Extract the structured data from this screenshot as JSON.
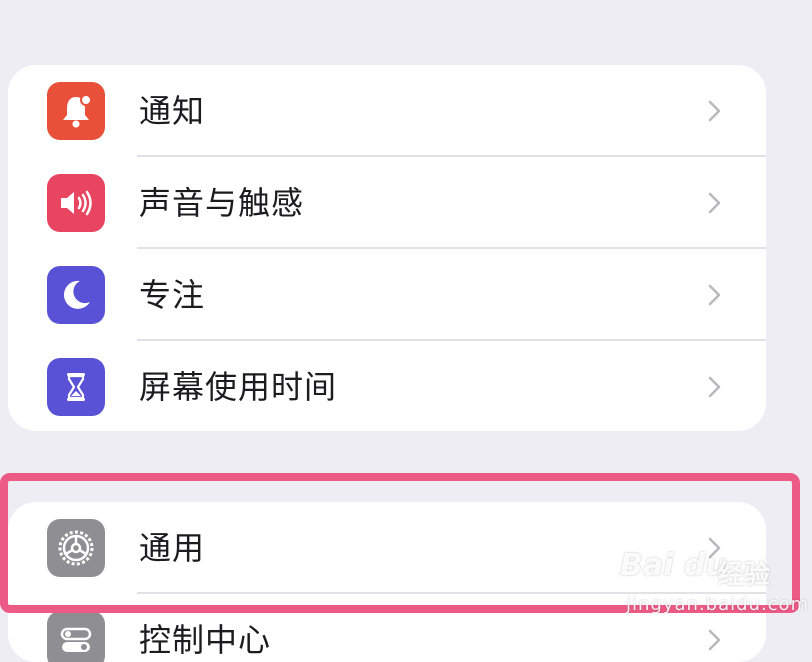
{
  "colors": {
    "background": "#eeedf3",
    "card": "#ffffff",
    "notifications_icon_bg": "#e8503a",
    "sounds_icon_bg": "#e84660",
    "focus_icon_bg": "#5a52d6",
    "screen_time_icon_bg": "#5a52d6",
    "general_icon_bg": "#8e8e93",
    "control_center_icon_bg": "#8e8e93",
    "highlight_border": "#ec5b86"
  },
  "settings": {
    "group1": [
      {
        "label": "通知",
        "icon": "bell-icon"
      },
      {
        "label": "声音与触感",
        "icon": "speaker-icon"
      },
      {
        "label": "专注",
        "icon": "moon-icon"
      },
      {
        "label": "屏幕使用时间",
        "icon": "hourglass-icon"
      }
    ],
    "group2": [
      {
        "label": "通用",
        "icon": "gear-icon"
      },
      {
        "label": "控制中心",
        "icon": "toggle-icon"
      }
    ]
  },
  "watermark": {
    "logo_text": "Bai du",
    "jingyan_text": "经验",
    "url": "jingyan.baidu.com"
  }
}
